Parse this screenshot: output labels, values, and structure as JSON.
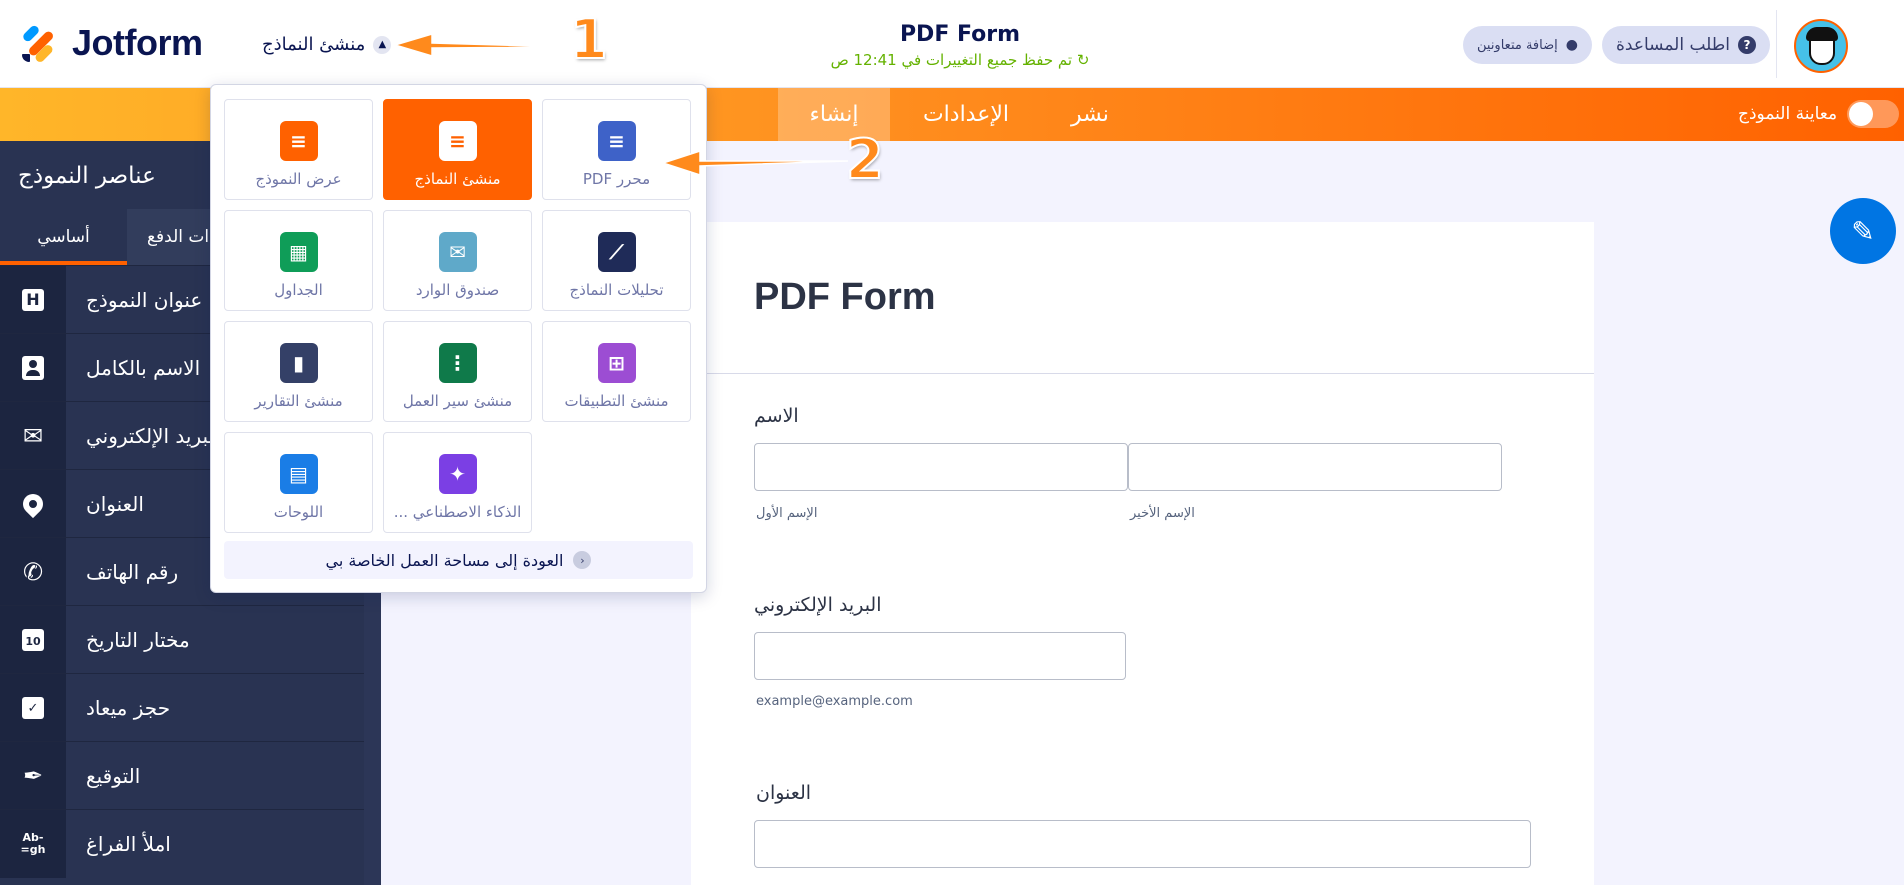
{
  "header": {
    "logo_text": "Jotform",
    "builder_switch_label": "منشئ النماذج",
    "form_title": "PDF Form",
    "save_status": "تم حفظ جميع التغييرات في 12:41 ص",
    "help_label": "اطلب المساعدة",
    "invite_label": "إضافة متعاونين"
  },
  "navbar": {
    "tabs": [
      "إنشاء",
      "الإعدادات",
      "نشر"
    ],
    "active_tab": "إنشاء",
    "preview_label": "معاينة النموذج",
    "preview_enabled": false
  },
  "sidebar": {
    "title": "عناصر النموذج",
    "tabs": [
      "أساسي",
      "ات الدفع"
    ],
    "active_tab": "أساسي",
    "items": [
      {
        "label": "عنوان النموذج",
        "icon": "heading-icon"
      },
      {
        "label": "الاسم بالكامل",
        "icon": "id-card-icon"
      },
      {
        "label": "البريد الإلكتروني",
        "icon": "envelope-icon"
      },
      {
        "label": "العنوان",
        "icon": "map-pin-icon"
      },
      {
        "label": "رقم الهاتف",
        "icon": "phone-icon"
      },
      {
        "label": "مختار التاريخ",
        "icon": "calendar-icon"
      },
      {
        "label": "حجز ميعاد",
        "icon": "calendar-check-icon"
      },
      {
        "label": "التوقيع",
        "icon": "pen-icon"
      },
      {
        "label": "املأ الفراغ",
        "icon": "fill-blank-icon",
        "icon_text": "Ab-gh"
      }
    ]
  },
  "dropdown": {
    "tiles": [
      {
        "label": "PDF محرر",
        "icon": "pdf-editor-icon",
        "color": "#3e62c8",
        "active": false
      },
      {
        "label": "منشئ النماذج",
        "icon": "form-builder-icon",
        "color": "#ffffff",
        "active": true
      },
      {
        "label": "عرض النموذج",
        "icon": "form-view-icon",
        "color": "#ff6100",
        "active": false
      },
      {
        "label": "تحليلات النماذج",
        "icon": "analytics-icon",
        "color": "#1f2b58",
        "active": false
      },
      {
        "label": "صندوق الوارد",
        "icon": "inbox-icon",
        "color": "#5fa9c9",
        "active": false
      },
      {
        "label": "الجداول",
        "icon": "tables-icon",
        "color": "#0f9d58",
        "active": false
      },
      {
        "label": "منشئ التطبيقات",
        "icon": "app-builder-icon",
        "color": "#9c4dd3",
        "active": false
      },
      {
        "label": "منشئ سير العمل",
        "icon": "workflow-icon",
        "color": "#0f7a4a",
        "active": false
      },
      {
        "label": "منشئ التقارير",
        "icon": "report-builder-icon",
        "color": "#344067",
        "active": false
      },
      {
        "label": "... الذكاء الاصطناعي",
        "icon": "ai-icon",
        "color": "#7b3fe4",
        "active": false
      },
      {
        "label": "اللوحات",
        "icon": "boards-icon",
        "color": "#1a7de6",
        "active": false
      }
    ],
    "back_label": "العودة إلى مساحة العمل الخاصة بي"
  },
  "form": {
    "title": "PDF Form",
    "name_label": "الاسم",
    "first_name_sub": "الإسم الأول",
    "last_name_sub": "الإسم الأخير",
    "email_label": "البريد الإلكتروني",
    "email_sub": "example@example.com",
    "address_label": "العنوان"
  },
  "annotations": {
    "step1": "1",
    "step2": "2"
  },
  "colors": {
    "brand_orange": "#ff6100",
    "navy": "#0a1551",
    "sidebar": "#293352",
    "save_green": "#64b200",
    "fab_blue": "#0075e3"
  }
}
